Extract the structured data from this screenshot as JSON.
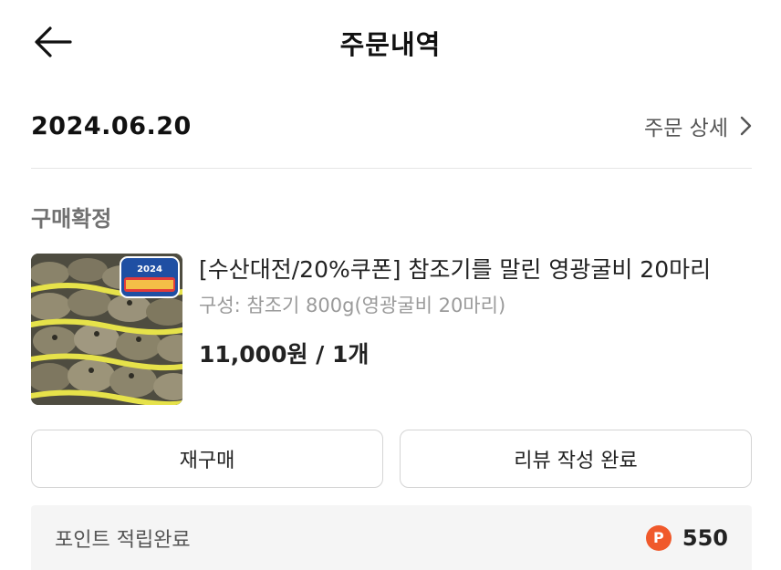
{
  "header": {
    "title": "주문내역",
    "back_icon": "arrow-left-icon"
  },
  "order": {
    "date": "2024.06.20",
    "detail_link_label": "주문 상세",
    "detail_icon": "chevron-right-icon",
    "status": "구매확정"
  },
  "product": {
    "name": "[수산대전/20%쿠폰] 참조기를 말린 영광굴비 20마리",
    "option": "구성: 참조기 800g(영광굴비 20마리)",
    "price": "11,000원 / 1개",
    "image_badge_text": "2024 대한민국수산대전"
  },
  "actions": {
    "rebuy_label": "재구매",
    "review_label": "리뷰 작성 완료"
  },
  "points": {
    "label": "포인트 적립완료",
    "badge": "P",
    "amount": "550",
    "badge_color": "#f0592b"
  }
}
